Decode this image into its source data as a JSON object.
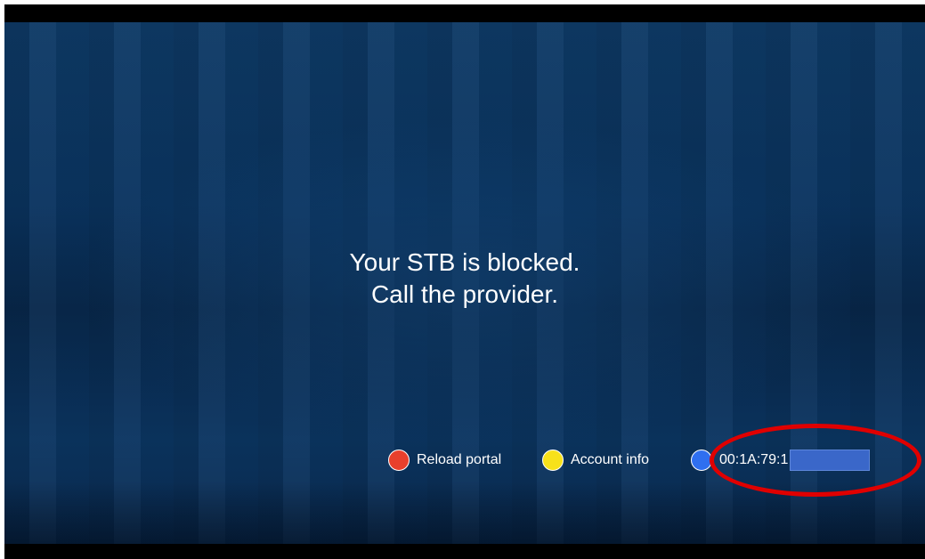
{
  "message": {
    "line1": "Your STB is blocked.",
    "line2": "Call the provider."
  },
  "footer": {
    "reload": {
      "color": "red",
      "label": "Reload portal"
    },
    "account": {
      "color": "yellow",
      "label": "Account info"
    },
    "mac": {
      "color": "blue",
      "value": "00:1A:79:1"
    }
  },
  "colors": {
    "background": "#0a3460",
    "red_key": "#e8402c",
    "yellow_key": "#f7e11a",
    "blue_key": "#2f6ff0",
    "annotation": "#e00000"
  }
}
